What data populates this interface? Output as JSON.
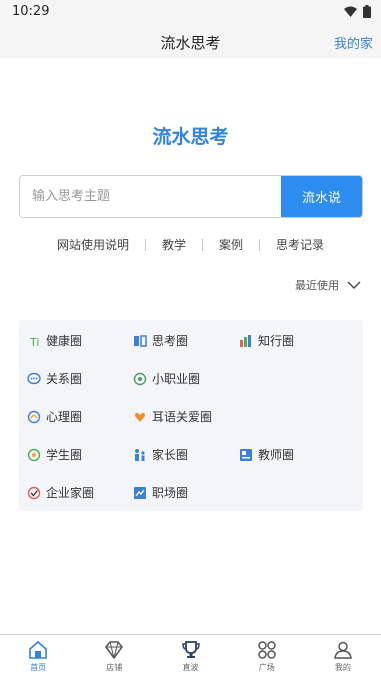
{
  "status": {
    "time": "10:29"
  },
  "nav": {
    "title": "流水思考",
    "right_link": "我的家"
  },
  "hero": {
    "title": "流水思考"
  },
  "search": {
    "placeholder": "输入思考主题",
    "button": "流水说"
  },
  "links": [
    "网站使用说明",
    "教学",
    "案例",
    "思考记录"
  ],
  "recent": {
    "label": "最近使用"
  },
  "circles": [
    {
      "label": "健康圈",
      "icon": "health-icon"
    },
    {
      "label": "思考圈",
      "icon": "thinking-icon"
    },
    {
      "label": "知行圈",
      "icon": "knowledge-action-icon"
    },
    {
      "label": "关系圈",
      "icon": "chat-bubble-icon"
    },
    {
      "label": "小职业圈",
      "icon": "career-icon"
    },
    {
      "label": "心理圈",
      "icon": "psychology-icon"
    },
    {
      "label": "耳语关爱圈",
      "icon": "care-icon"
    },
    {
      "label": "学生圈",
      "icon": "student-icon"
    },
    {
      "label": "家长圈",
      "icon": "parent-icon"
    },
    {
      "label": "教师圈",
      "icon": "teacher-icon"
    },
    {
      "label": "企业家圈",
      "icon": "entrepreneur-icon"
    },
    {
      "label": "职场圈",
      "icon": "workplace-icon"
    }
  ],
  "tabs": [
    {
      "label": "首页",
      "icon": "home-icon",
      "active": true
    },
    {
      "label": "店铺",
      "icon": "diamond-icon",
      "active": false
    },
    {
      "label": "直波",
      "icon": "trophy-icon",
      "active": false
    },
    {
      "label": "广场",
      "icon": "grid-icon",
      "active": false
    },
    {
      "label": "我的",
      "icon": "user-icon",
      "active": false
    }
  ],
  "colors": {
    "accent": "#2f84e0",
    "button": "#2d8cf0",
    "panel": "#f4f5f8"
  }
}
